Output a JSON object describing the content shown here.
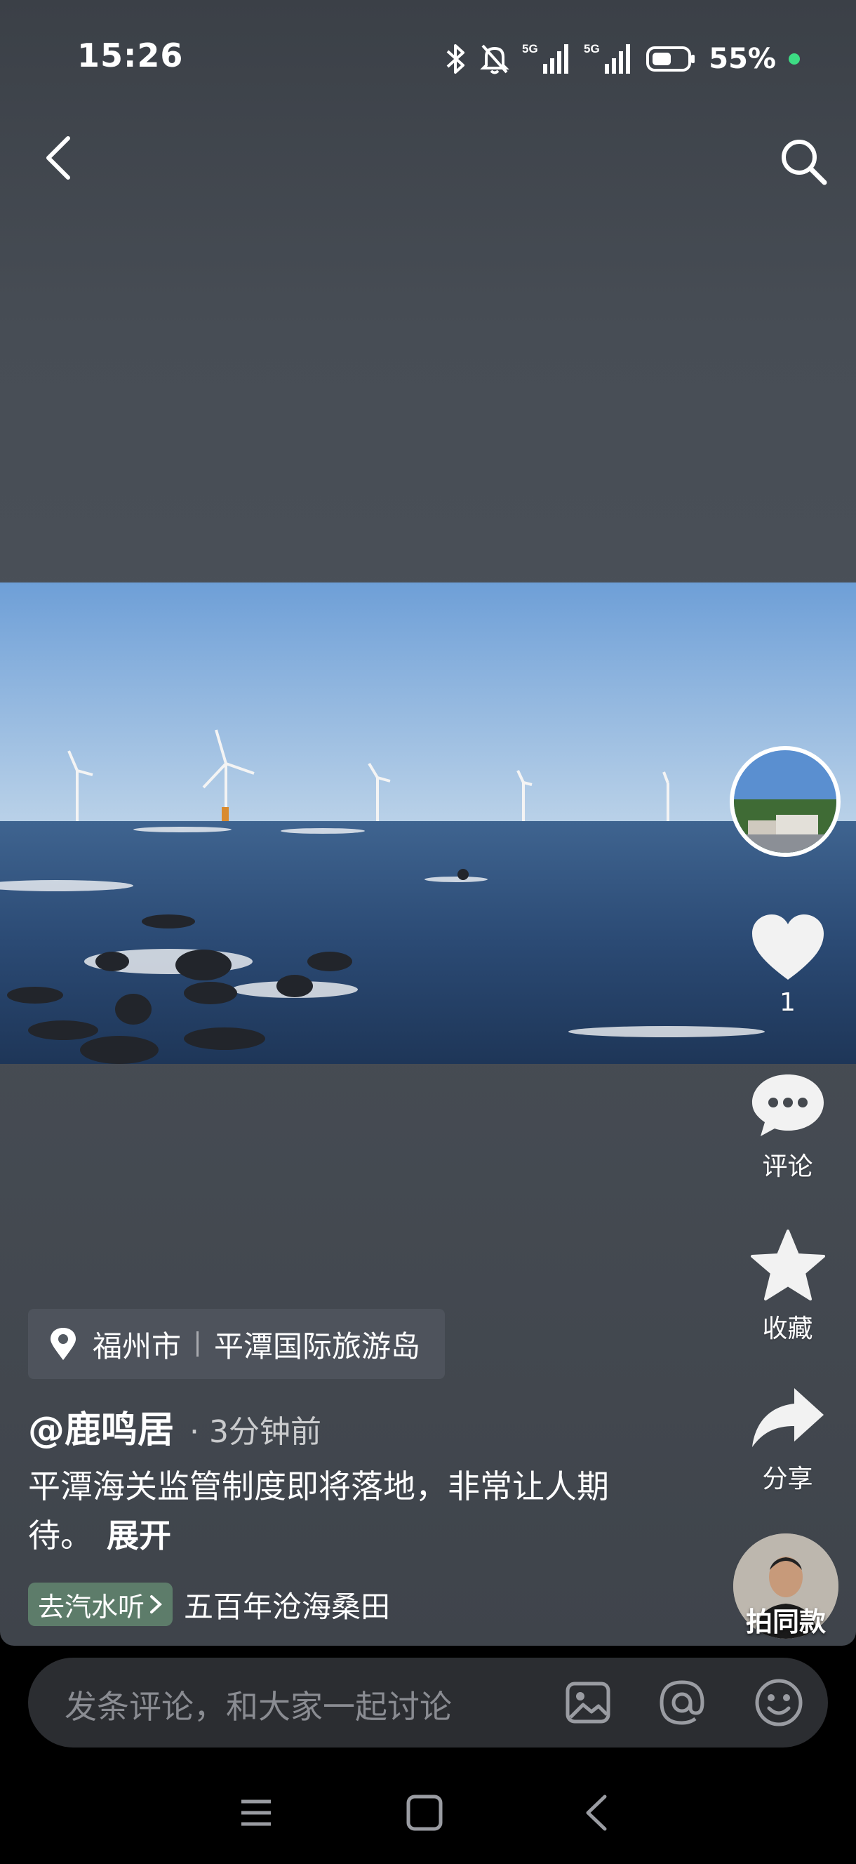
{
  "status_bar": {
    "time": "15:26",
    "battery": "55%",
    "icons": [
      "bluetooth-icon",
      "mute-bell-icon",
      "signal-5g-icon",
      "signal-5g-icon",
      "battery-icon"
    ]
  },
  "header": {
    "back_icon": "chevron-left-icon",
    "search_icon": "search-icon"
  },
  "actions": {
    "like_count": "1",
    "comment_label": "评论",
    "collect_label": "收藏",
    "share_label": "分享",
    "remix_label": "拍同款"
  },
  "post": {
    "location_city": "福州市",
    "location_place": "平潭国际旅游岛",
    "author": "@鹿鸣居",
    "time_ago": "· 3分钟前",
    "description": "平潭海关监管制度即将落地，非常让人期待。",
    "expand_label": "展开",
    "music_chip": "去汽水听",
    "music_title": "五百年沧海桑田"
  },
  "comment_bar": {
    "placeholder": "发条评论，和大家一起讨论"
  },
  "colors": {
    "background": "#42474e",
    "music_chip": "#5d7c6a",
    "comment_bar": "#2b2d31"
  }
}
